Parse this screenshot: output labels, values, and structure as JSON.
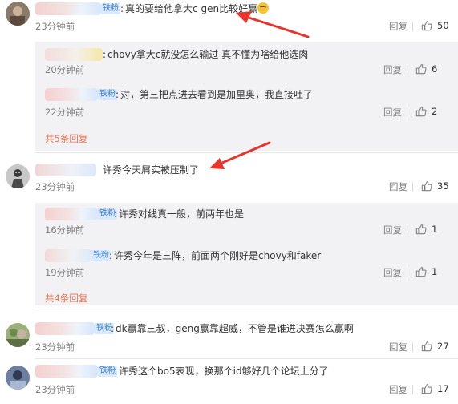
{
  "comments": [
    {
      "badge": "铁粉",
      "text": "真的要给他拿大c gen比较好赢",
      "emoji": "doge-emoji",
      "time": "23分钟前",
      "reply": "回复",
      "likes": "50",
      "replies": [
        {
          "badge": "",
          "text": "chovy拿大c就没怎么输过 真不懂为啥给他选肉",
          "time": "20分钟前",
          "reply": "回复",
          "likes": "6"
        },
        {
          "badge": "铁粉",
          "text": "对，第三把点进去看到是加里奥，我直接吐了",
          "time": "22分钟前",
          "reply": "回复",
          "likes": "2"
        }
      ],
      "more": "共5条回复"
    },
    {
      "badge": "",
      "text": "许秀今天屑实被压制了",
      "time": "23分钟前",
      "reply": "回复",
      "likes": "35",
      "replies": [
        {
          "badge": "铁粉",
          "text": "许秀对线真一般，前两年也是",
          "time": "16分钟前",
          "reply": "回复",
          "likes": "1"
        },
        {
          "badge": "铁粉",
          "text": "许秀今年是三阵，前面两个刚好是chovy和faker",
          "time": "19分钟前",
          "reply": "回复",
          "likes": "1"
        }
      ],
      "more": "共4条回复"
    },
    {
      "badge": "铁粉",
      "text": "dk赢靠三叔，geng赢靠超威，不管是谁进决赛怎么赢啊",
      "time": "23分钟前",
      "reply": "回复",
      "likes": "27"
    },
    {
      "badge": "铁粉",
      "text": "许秀这个bo5表现，换那个id够好几个论坛上分了",
      "time": "23分钟前",
      "reply": "回复",
      "likes": "17"
    }
  ],
  "colors": {
    "accent": "#eb7350",
    "arrow": "#e8342c",
    "badge_bg": "#d9e9ff",
    "badge_text": "#3f83c9",
    "panel_bg": "#f2f2f5"
  },
  "icons": {
    "like": "thumbs-up-icon"
  }
}
